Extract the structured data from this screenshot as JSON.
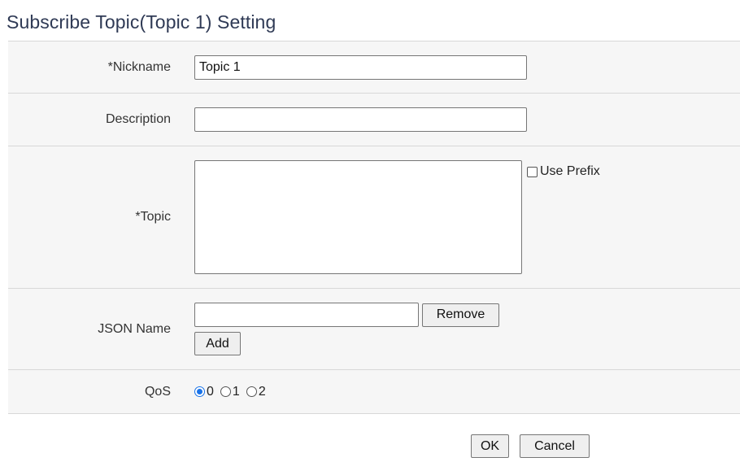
{
  "title": "Subscribe Topic(Topic 1) Setting",
  "nickname": {
    "label": "*Nickname",
    "value": "Topic 1"
  },
  "description": {
    "label": "Description",
    "value": ""
  },
  "topic": {
    "label": "*Topic",
    "value": "",
    "use_prefix_label": "Use Prefix",
    "use_prefix_checked": false
  },
  "json_name": {
    "label": "JSON Name",
    "value": "",
    "remove_label": "Remove",
    "add_label": "Add"
  },
  "qos": {
    "label": "QoS",
    "options": [
      "0",
      "1",
      "2"
    ],
    "selected": "0"
  },
  "actions": {
    "ok_label": "OK",
    "cancel_label": "Cancel"
  },
  "colors": {
    "title": "#2f3a55",
    "form_bg": "#f6f6f6",
    "radio_accent": "#1a73e8"
  }
}
